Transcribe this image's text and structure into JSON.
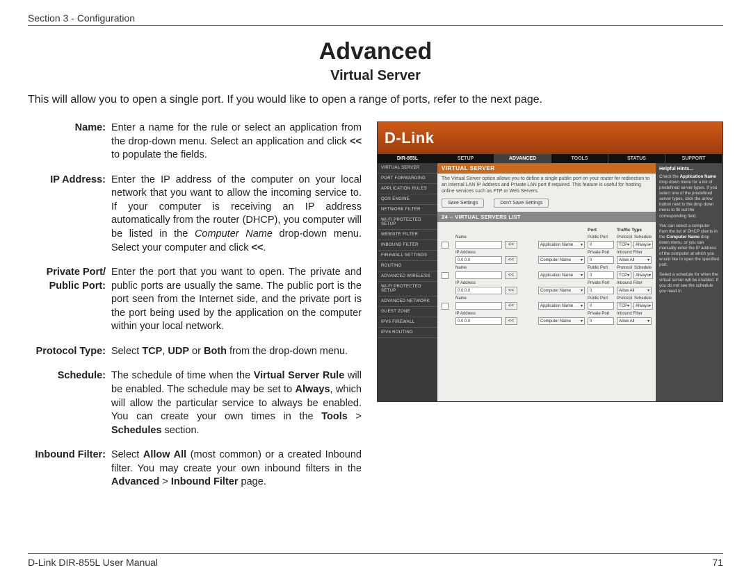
{
  "header": "Section 3 - Configuration",
  "title": "Advanced",
  "subtitle": "Virtual Server",
  "intro": "This will allow you to open a single port. If you would like to open a range of ports, refer to the next page.",
  "footer_left": "D-Link DIR-855L User Manual",
  "footer_right": "71",
  "defs": {
    "name_label": "Name:",
    "name_text_a": "Enter a name for the rule or select an application from the drop-down menu. Select an application and click ",
    "name_text_b": "<<",
    "name_text_c": " to populate the fields.",
    "ip_label": "IP Address:",
    "ip_text_a": "Enter the IP address of the computer on your local network that you want to allow the incoming service to. If your computer is receiving an IP address automatically from the router (DHCP), you computer will be listed in the ",
    "ip_text_b": "Computer Name",
    "ip_text_c": " drop-down menu. Select your computer and click ",
    "ip_text_d": "<<",
    "ip_text_e": ".",
    "pp_label1": "Private Port/",
    "pp_label2": "Public Port:",
    "pp_text": "Enter the port that you want to open. The private and public ports are usually the same. The public port is the port seen from the Internet side, and the private port is the port being used by the application on the computer within your local network.",
    "proto_label": "Protocol Type:",
    "proto_a": "Select ",
    "proto_b": "TCP",
    "proto_c": ", ",
    "proto_d": "UDP",
    "proto_e": " or ",
    "proto_f": "Both",
    "proto_g": " from the drop-down menu.",
    "sched_label": "Schedule:",
    "sched_a": "The schedule of time when the ",
    "sched_b": "Virtual Server Rule",
    "sched_c": " will be enabled. The schedule may be set to ",
    "sched_d": "Always",
    "sched_e": ", which will allow the particular service to always be enabled. You can create your own times in the ",
    "sched_f": "Tools",
    "sched_g": " > ",
    "sched_h": "Schedules",
    "sched_i": " section.",
    "if_label": "Inbound Filter:",
    "if_a": "Select ",
    "if_b": "Allow All",
    "if_c": " (most common) or a created Inbound filter. You may create your own inbound filters in the ",
    "if_d": "Advanced",
    "if_e": " > ",
    "if_f": "Inbound Filter",
    "if_g": " page."
  },
  "shot": {
    "brand": "D-Link",
    "model": "DIR-855L",
    "tabs": [
      "SETUP",
      "ADVANCED",
      "TOOLS",
      "STATUS",
      "SUPPORT"
    ],
    "side": [
      "VIRTUAL SERVER",
      "PORT FORWARDING",
      "APPLICATION RULES",
      "QOS ENGINE",
      "NETWORK FILTER",
      "WI-FI PROTECTED SETUP",
      "WEBSITE FILTER",
      "INBOUND FILTER",
      "FIREWALL SETTINGS",
      "ROUTING",
      "ADVANCED WIRELESS",
      "WI-FI PROTECTED SETUP",
      "ADVANCED NETWORK",
      "GUEST ZONE",
      "IPV6 FIREWALL",
      "IPV6 ROUTING"
    ],
    "vs_title": "VIRTUAL SERVER",
    "vs_desc": "The Virtual Server option allows you to define a single public port on your router for redirection to an internal LAN IP Address and Private LAN port if required. This feature is useful for hosting online services such as FTP or Web Servers.",
    "btn_save": "Save Settings",
    "btn_dont": "Don't Save Settings",
    "list_title": "24 -- VIRTUAL SERVERS LIST",
    "col_port": "Port",
    "col_traffic": "Traffic Type",
    "lbl_name": "Name",
    "lbl_ip": "IP Address",
    "lbl_pubport": "Public Port",
    "lbl_privport": "Private Port",
    "lbl_protocol": "Protocol",
    "lbl_schedule": "Schedule",
    "lbl_inbound": "Inbound Filter",
    "sel_app": "Application Name",
    "sel_comp": "Computer Name",
    "sel_tcp": "TCP",
    "sel_always": "Always",
    "sel_allow": "Allow All",
    "val_0": "0",
    "val_ip": "0.0.0.0",
    "arrow": "<<",
    "dd": "▾",
    "hints_title": "Helpful Hints...",
    "hints_p1a": "Check the ",
    "hints_p1b": "Application Name",
    "hints_p1c": " drop down menu for a list of predefined server types. If you select one of the predefined server types, click the arrow button next to the drop down menu to fill out the corresponding field.",
    "hints_p2a": "You can select a computer from the list of DHCP clients in the ",
    "hints_p2b": "Computer Name",
    "hints_p2c": " drop down menu, or you can manually enter the IP address of the computer at which you would like to open the specified port.",
    "hints_p3": "Select a schedule for when the virtual server will be enabled. If you do not see the schedule you need in"
  }
}
